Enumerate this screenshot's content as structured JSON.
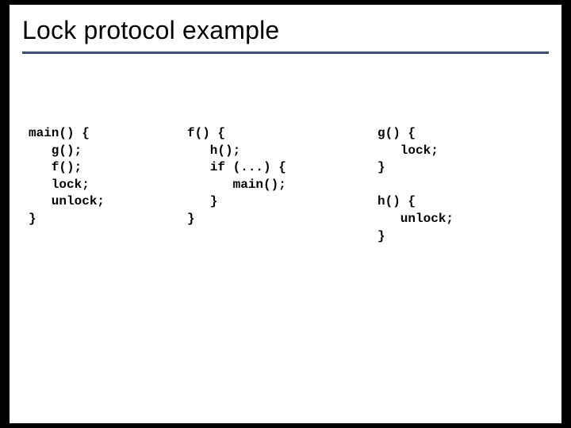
{
  "title": "Lock protocol example",
  "code": {
    "main": "main() {\n   g();\n   f();\n   lock;\n   unlock;\n}",
    "f": "f() {\n   h();\n   if (...) {\n      main();\n   }\n}",
    "gh": "g() {\n   lock;\n}\n\nh() {\n   unlock;\n}"
  }
}
